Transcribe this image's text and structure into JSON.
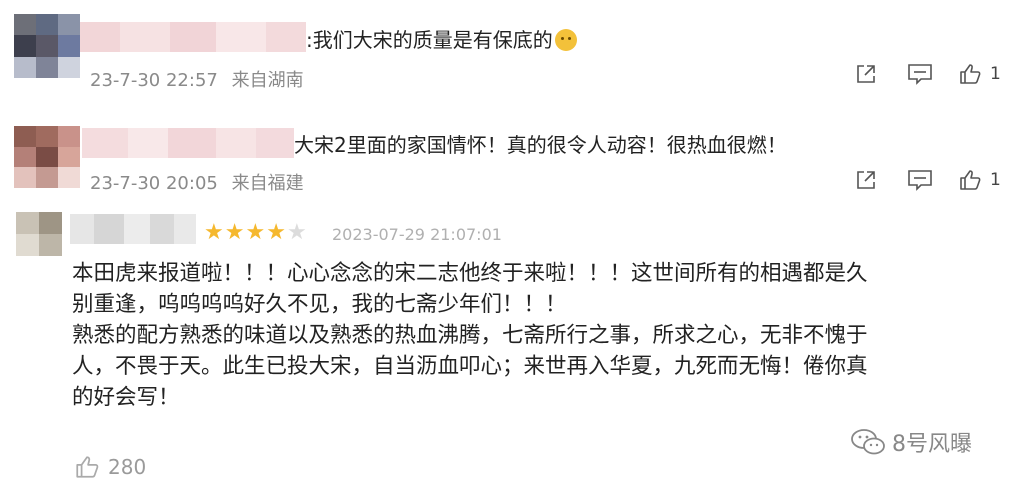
{
  "comments": [
    {
      "text": "我们大宋的质量是有保底的",
      "emoji": "cat-emoji",
      "time": "23-7-30 22:57",
      "location": "来自湖南",
      "like_count": "1"
    },
    {
      "text": "大宋2里面的家国情怀！真的很令人动容！很热血很燃！",
      "time": "23-7-30 20:05",
      "location": "来自福建",
      "like_count": "1"
    }
  ],
  "review": {
    "rating": 4,
    "rating_max": 5,
    "date": "2023-07-29 21:07:01",
    "paragraph1_line1": "本田虎来报道啦！！！心心念念的宋二志他终于来啦！！！这世间所有的相遇都是久",
    "paragraph1_line2": "别重逢，呜呜呜呜好久不见，我的七斋少年们！！！",
    "paragraph2_line1": "熟悉的配方熟悉的味道以及熟悉的热血沸腾，七斋所行之事，所求之心，无非不愧于",
    "paragraph2_line2": "人，不畏于天。此生已投大宋，自当沥血叩心；来世再入华夏，九死而无悔！倦你真",
    "paragraph2_line3": "的好会写！",
    "like_count": "280"
  },
  "watermark": {
    "text": "8号风曝",
    "icon": "wechat-icon"
  },
  "colors": {
    "star_active": "#f5b82e",
    "star_inactive": "#dcdcdc",
    "meta_text": "#8a8a8a"
  }
}
